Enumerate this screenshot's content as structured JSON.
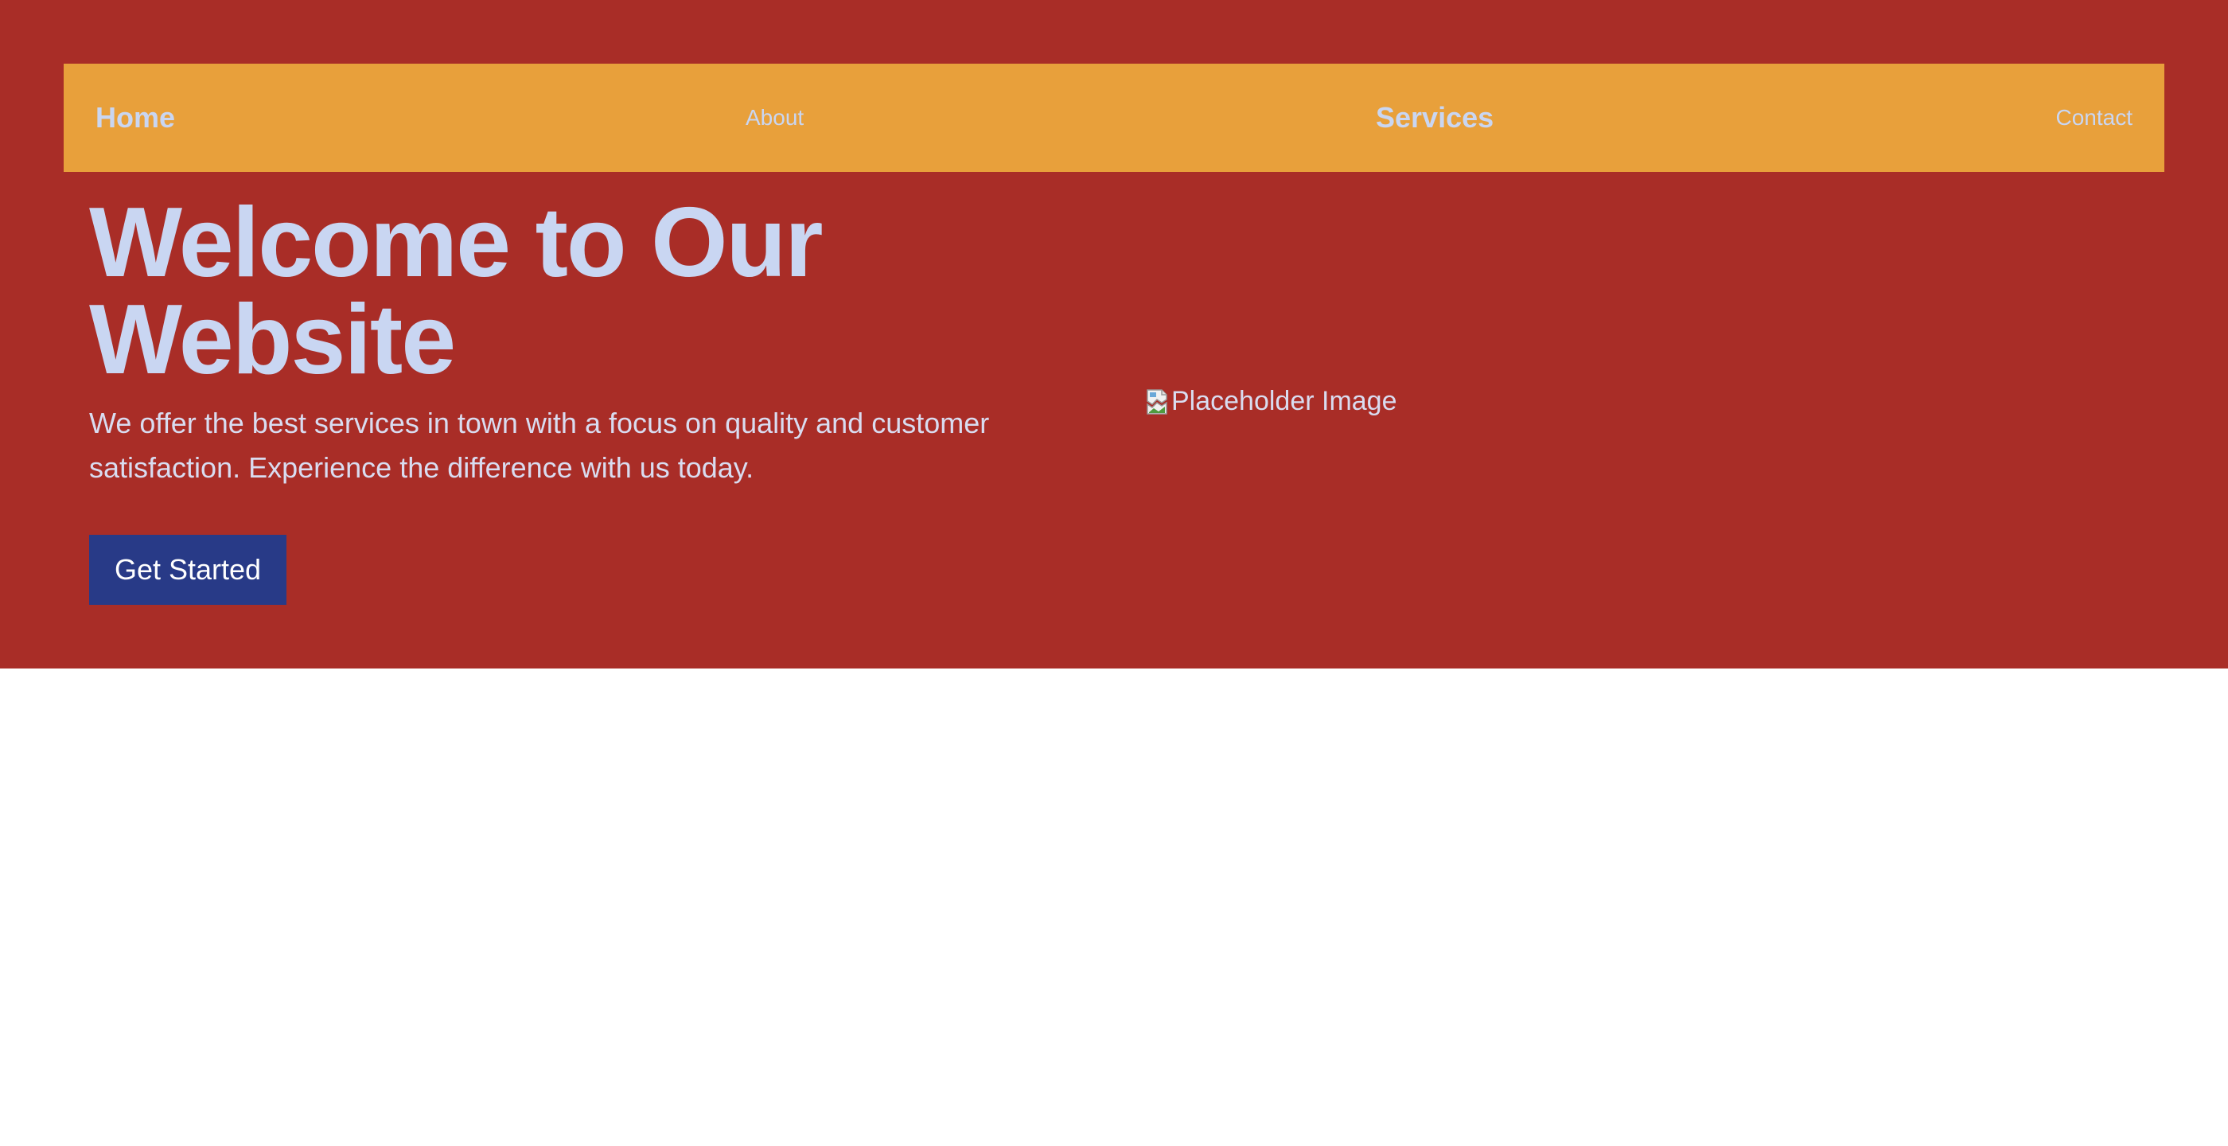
{
  "nav": {
    "items": [
      {
        "label": "Home"
      },
      {
        "label": "About"
      },
      {
        "label": "Services"
      },
      {
        "label": "Contact"
      }
    ]
  },
  "hero": {
    "title": "Welcome to Our Website",
    "description": "We offer the best services in town with a focus on quality and customer satisfaction. Experience the difference with us today.",
    "cta_label": "Get Started",
    "image_alt": "Placeholder Image"
  },
  "icons": {
    "broken_image": "broken-image-icon"
  },
  "colors": {
    "hero_background": "#a92d27",
    "navbar_background": "#e8a03b",
    "text_light": "#c9d6f2",
    "cta_background": "#283a87",
    "page_background": "#ffffff"
  }
}
